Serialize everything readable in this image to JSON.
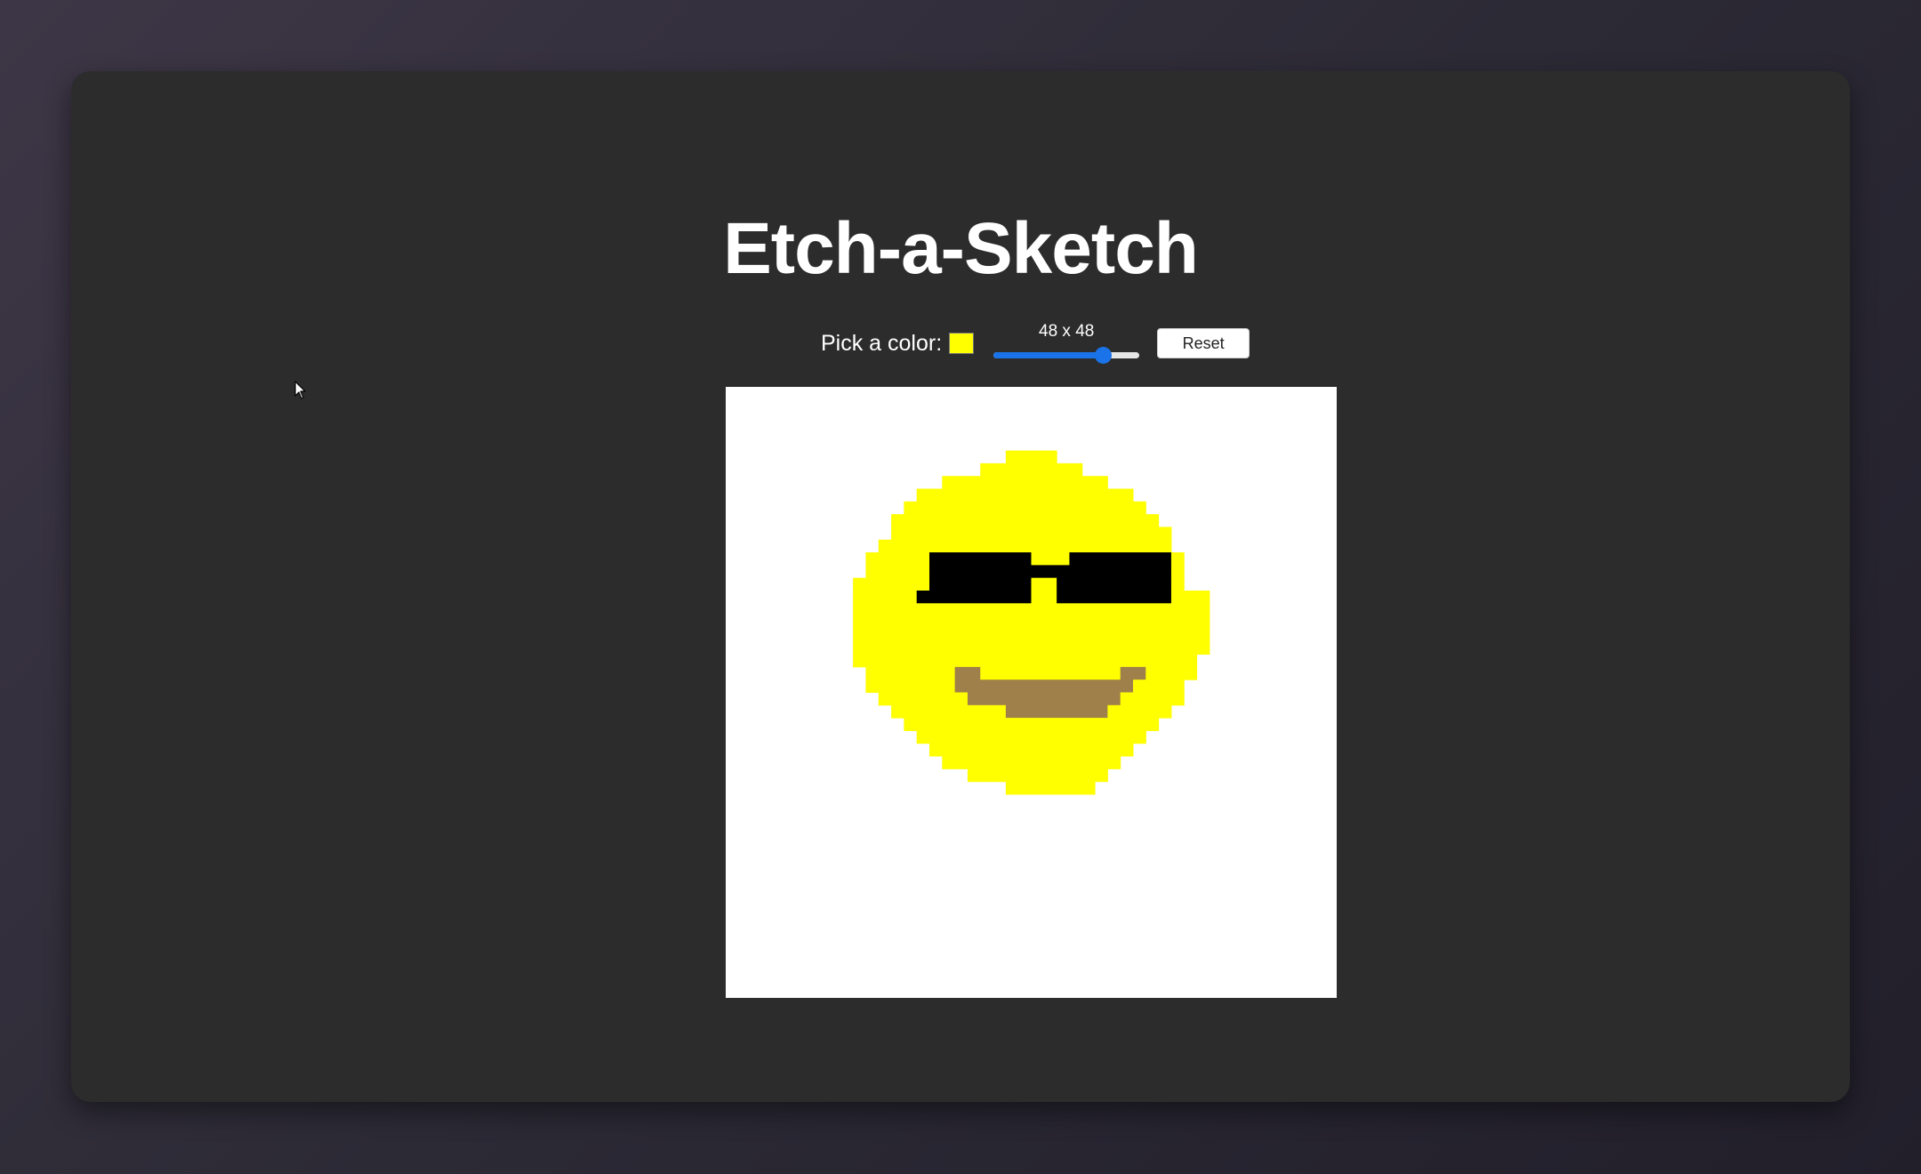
{
  "app": {
    "title": "Etch-a-Sketch"
  },
  "controls": {
    "color_label": "Pick a color:",
    "selected_color": "#ffff00",
    "grid_size_label": "48 x 48",
    "grid_size": 48,
    "grid_size_range": [
      1,
      64
    ],
    "reset_label": "Reset"
  },
  "icons": {
    "cursor": "arrow-cursor-icon"
  },
  "canvas": {
    "grid_size": 48,
    "background": "#ffffff",
    "palette": {
      "Y": "#ffff00",
      "K": "#000000",
      "B": "#a0804a"
    },
    "drawing": {
      "ordinal_unit": "cells (0-47)",
      "row_start": 5,
      "rows": [
        {
          "row": 5,
          "runs": [
            [
              22,
              25,
              "Y"
            ]
          ]
        },
        {
          "row": 6,
          "runs": [
            [
              20,
              27,
              "Y"
            ]
          ]
        },
        {
          "row": 7,
          "runs": [
            [
              17,
              29,
              "Y"
            ]
          ]
        },
        {
          "row": 8,
          "runs": [
            [
              15,
              31,
              "Y"
            ]
          ]
        },
        {
          "row": 9,
          "runs": [
            [
              14,
              32,
              "Y"
            ]
          ]
        },
        {
          "row": 10,
          "runs": [
            [
              13,
              33,
              "Y"
            ]
          ]
        },
        {
          "row": 11,
          "runs": [
            [
              13,
              34,
              "Y"
            ]
          ]
        },
        {
          "row": 12,
          "runs": [
            [
              12,
              34,
              "Y"
            ]
          ]
        },
        {
          "row": 13,
          "runs": [
            [
              11,
              15,
              "Y"
            ],
            [
              16,
              23,
              "K"
            ],
            [
              24,
              26,
              "Y"
            ],
            [
              27,
              34,
              "K"
            ],
            [
              35,
              35,
              "Y"
            ]
          ]
        },
        {
          "row": 14,
          "runs": [
            [
              11,
              15,
              "Y"
            ],
            [
              16,
              23,
              "K"
            ],
            [
              24,
              26,
              "K"
            ],
            [
              27,
              34,
              "K"
            ],
            [
              35,
              35,
              "Y"
            ]
          ]
        },
        {
          "row": 15,
          "runs": [
            [
              10,
              15,
              "Y"
            ],
            [
              16,
              23,
              "K"
            ],
            [
              24,
              25,
              "Y"
            ],
            [
              26,
              34,
              "K"
            ],
            [
              35,
              35,
              "Y"
            ]
          ]
        },
        {
          "row": 16,
          "runs": [
            [
              10,
              14,
              "Y"
            ],
            [
              15,
              23,
              "K"
            ],
            [
              24,
              25,
              "Y"
            ],
            [
              26,
              34,
              "K"
            ],
            [
              35,
              37,
              "Y"
            ]
          ]
        },
        {
          "row": 17,
          "runs": [
            [
              10,
              37,
              "Y"
            ]
          ]
        },
        {
          "row": 18,
          "runs": [
            [
              10,
              37,
              "Y"
            ]
          ]
        },
        {
          "row": 19,
          "runs": [
            [
              10,
              37,
              "Y"
            ]
          ]
        },
        {
          "row": 20,
          "runs": [
            [
              10,
              37,
              "Y"
            ]
          ]
        },
        {
          "row": 21,
          "runs": [
            [
              10,
              36,
              "Y"
            ]
          ]
        },
        {
          "row": 22,
          "runs": [
            [
              11,
              17,
              "Y"
            ],
            [
              18,
              19,
              "B"
            ],
            [
              20,
              30,
              "Y"
            ],
            [
              31,
              32,
              "B"
            ],
            [
              33,
              36,
              "Y"
            ]
          ]
        },
        {
          "row": 23,
          "runs": [
            [
              11,
              17,
              "Y"
            ],
            [
              18,
              31,
              "B"
            ],
            [
              32,
              35,
              "Y"
            ]
          ]
        },
        {
          "row": 24,
          "runs": [
            [
              12,
              18,
              "Y"
            ],
            [
              19,
              30,
              "B"
            ],
            [
              31,
              35,
              "Y"
            ]
          ]
        },
        {
          "row": 25,
          "runs": [
            [
              13,
              21,
              "Y"
            ],
            [
              22,
              29,
              "B"
            ],
            [
              30,
              34,
              "Y"
            ]
          ]
        },
        {
          "row": 26,
          "runs": [
            [
              14,
              33,
              "Y"
            ]
          ]
        },
        {
          "row": 27,
          "runs": [
            [
              15,
              32,
              "Y"
            ]
          ]
        },
        {
          "row": 28,
          "runs": [
            [
              16,
              31,
              "Y"
            ]
          ]
        },
        {
          "row": 29,
          "runs": [
            [
              17,
              30,
              "Y"
            ]
          ]
        },
        {
          "row": 30,
          "runs": [
            [
              19,
              29,
              "Y"
            ]
          ]
        },
        {
          "row": 31,
          "runs": [
            [
              22,
              28,
              "Y"
            ]
          ]
        }
      ]
    }
  }
}
